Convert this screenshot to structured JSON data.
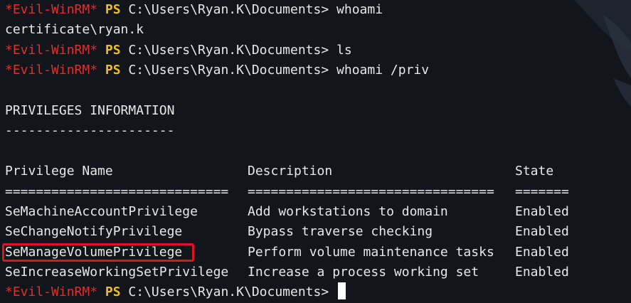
{
  "prompt": {
    "name": "*Evil-WinRM*",
    "ps": "PS",
    "path": "C:\\Users\\Ryan.K\\Documents>"
  },
  "commands": {
    "cmd1": "whoami",
    "cmd1_output": "certificate\\ryan.k",
    "cmd2": "ls",
    "cmd3": "whoami /priv"
  },
  "privileges": {
    "title": "PRIVILEGES INFORMATION",
    "title_underline": "----------------------",
    "headers": {
      "name": "Privilege Name",
      "description": "Description",
      "state": "State"
    },
    "separators": {
      "name": "=============================",
      "description": "================================",
      "state": "======="
    },
    "rows": [
      {
        "name": "SeMachineAccountPrivilege",
        "description": "Add workstations to domain",
        "state": "Enabled"
      },
      {
        "name": "SeChangeNotifyPrivilege",
        "description": "Bypass traverse checking",
        "state": "Enabled"
      },
      {
        "name": "SeManageVolumePrivilege",
        "description": "Perform volume maintenance tasks",
        "state": "Enabled",
        "highlighted": true
      },
      {
        "name": "SeIncreaseWorkingSetPrivilege",
        "description": "Increase a process working set",
        "state": "Enabled"
      }
    ]
  },
  "colors": {
    "background": "#12151b",
    "prompt_name": "#e0302b",
    "prompt_ps": "#f0c020",
    "text": "#e8e8e8",
    "highlight": "#e0141b"
  }
}
